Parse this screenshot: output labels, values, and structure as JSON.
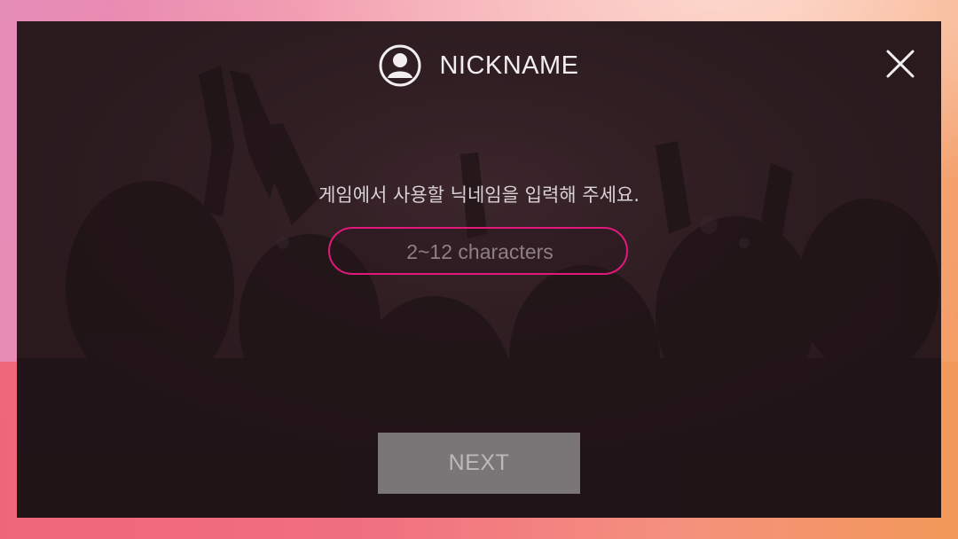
{
  "dialog": {
    "title": "NICKNAME",
    "prompt": "게임에서 사용할 닉네임을 입력해 주세요.",
    "nickname_input": {
      "value": "",
      "placeholder": "2~12 characters"
    },
    "next_label": "NEXT"
  },
  "icons": {
    "header": "user-avatar-icon",
    "close": "close-icon"
  },
  "colors": {
    "accent": "#e0197b",
    "panel": "#2a1a1e",
    "button_disabled": "#7a7678"
  }
}
